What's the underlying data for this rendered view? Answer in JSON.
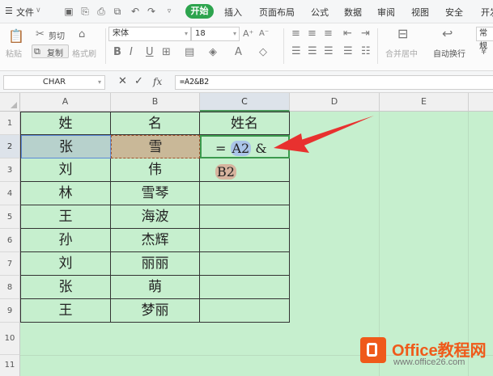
{
  "menubar": {
    "file_label": "文件",
    "tabs": [
      "开始",
      "插入",
      "页面布局",
      "公式",
      "数据",
      "审阅",
      "视图",
      "安全",
      "开发"
    ],
    "active_tab_color": "#2da44e"
  },
  "ribbon": {
    "paste_label": "粘贴",
    "cut_label": "剪切",
    "copy_label": "复制",
    "format_painter_label": "格式刷",
    "font_name": "宋体",
    "font_size": "18",
    "merge_label": "合并居中",
    "wrap_label": "自动换行",
    "number_format": "常规"
  },
  "formula_bar": {
    "name_box": "CHAR",
    "fx_label": "fx",
    "formula": "=A2&B2"
  },
  "sheet": {
    "columns": [
      "A",
      "B",
      "C",
      "D",
      "E"
    ],
    "rows": [
      "1",
      "2",
      "3",
      "4",
      "5",
      "6",
      "7",
      "8",
      "9",
      "10",
      "11"
    ],
    "header": {
      "a": "姓",
      "b": "名",
      "c": "姓名"
    },
    "data": [
      {
        "a": "张",
        "b": "雪"
      },
      {
        "a": "刘",
        "b": "伟"
      },
      {
        "a": "林",
        "b": "雪琴"
      },
      {
        "a": "王",
        "b": "海波"
      },
      {
        "a": "孙",
        "b": "杰辉"
      },
      {
        "a": "刘",
        "b": "丽丽"
      },
      {
        "a": "张",
        "b": "萌"
      },
      {
        "a": "王",
        "b": "梦丽"
      }
    ],
    "editing_formula": {
      "eq": "=",
      "ref1": "A2",
      "amp": "&",
      "ref2": "B2"
    },
    "background_color": "#c6efce",
    "arrow_color": "#e8312f"
  },
  "watermark": {
    "title": "Office教程网",
    "url": "www.office26.com",
    "brand_color": "#ef5a1a"
  }
}
